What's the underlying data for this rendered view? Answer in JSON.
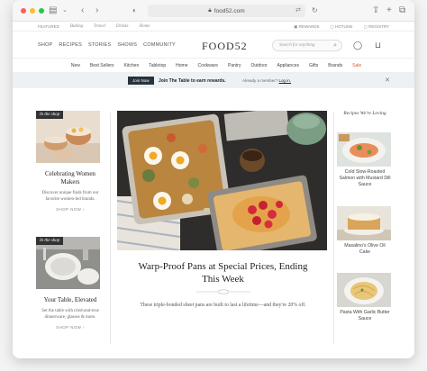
{
  "browser": {
    "url": "food52.com",
    "lock_icon": "lock-icon",
    "reader_icon": "reader-icon"
  },
  "utility_bar": {
    "featured": "FEATURED",
    "links": [
      "Baking",
      "Travel",
      "Drinks",
      "Home"
    ],
    "rewards": "REWARDS",
    "hotline": "HOTLINE",
    "registry": "REGISTRY"
  },
  "nav": {
    "links": [
      "SHOP",
      "RECIPES",
      "STORIES",
      "SHOWS",
      "COMMUNITY"
    ],
    "logo": "FOOD52",
    "search_placeholder": "Search for anything"
  },
  "categories": [
    "New",
    "Best Sellers",
    "Kitchen",
    "Tabletop",
    "Home",
    "Cookware",
    "Pantry",
    "Outdoor",
    "Appliances",
    "Gifts",
    "Brands",
    "Sale"
  ],
  "banner": {
    "button": "Join Now",
    "message": "Join The Table to earn rewards.",
    "member_text": "Already a member?",
    "login": "Log in."
  },
  "left_cards": [
    {
      "tag": "In the shop",
      "title": "Celebrating Women Makers",
      "desc": "Discover unique finds from our favorite women-led brands.",
      "cta": "SHOP NOW"
    },
    {
      "tag": "In the shop",
      "title": "Your Table, Elevated",
      "desc": "Set the table with tried-and-true dinnerware, glasses & more.",
      "cta": "SHOP NOW"
    }
  ],
  "hero": {
    "title": "Warp-Proof Pans at Special Prices, Ending This Week",
    "desc": "These triple-bonded sheet pans are built to last a lifetime—and they're 20% off."
  },
  "right_col": {
    "heading": "Recipes We're Loving",
    "recipes": [
      {
        "title": "Cold Slow-Roasted Salmon with Mustard Dill Sauce"
      },
      {
        "title": "Masalino's Olive Oil Cake"
      },
      {
        "title": "Pasta With Garlic Butter Sauce"
      }
    ]
  },
  "colors": {
    "accent_sale": "#d06030",
    "join_button": "#26323c",
    "banner_bg": "#eef1f3"
  }
}
